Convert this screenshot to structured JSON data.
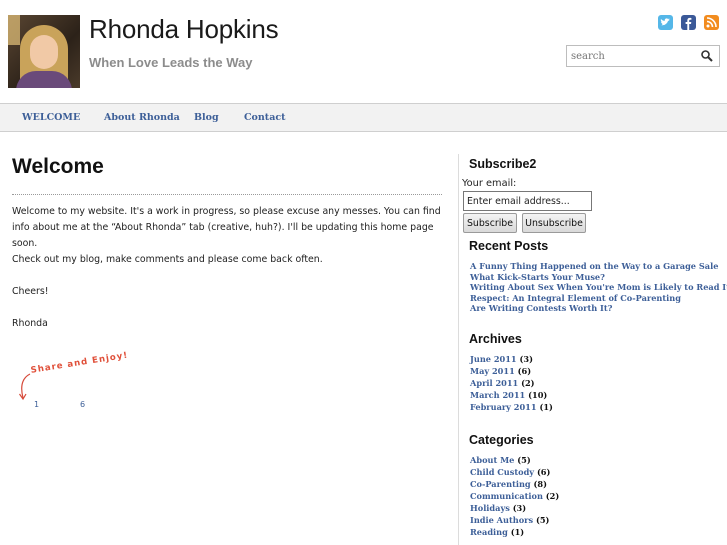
{
  "site": {
    "title": "Rhonda Hopkins",
    "tagline": "When Love Leads the Way"
  },
  "header": {
    "social": [
      {
        "icon": "twitter-icon",
        "color": "#55b7e8"
      },
      {
        "icon": "facebook-icon",
        "color": "#3b5998"
      },
      {
        "icon": "rss-icon",
        "color": "#f28c1f"
      }
    ],
    "search": {
      "placeholder": "search"
    }
  },
  "nav": {
    "items": [
      "WELCOME",
      "About Rhonda",
      "Blog",
      "Contact"
    ]
  },
  "main": {
    "title": "Welcome",
    "paragraphs": [
      "Welcome to my website. It's a work in progress, so please excuse any messes. You can find info about me at the “About Rhonda” tab (creative, huh?). I'll be updating this home page soon.",
      "Check out my blog, make comments and please come back often.",
      "Cheers!",
      "Rhonda"
    ],
    "share": {
      "label": "Share and Enjoy!",
      "counts": [
        "1",
        "6"
      ]
    }
  },
  "sidebar": {
    "subscribe": {
      "title": "Subscribe2",
      "email_label": "Your email:",
      "email_value": "Enter email address...",
      "subscribe_label": "Subscribe",
      "unsubscribe_label": "Unsubscribe"
    },
    "recent_posts": {
      "title": "Recent Posts",
      "items": [
        "A Funny Thing Happened on the Way to a Garage Sale",
        "What Kick-Starts Your Muse?",
        "Writing About Sex When You're Mom is Likely to Read It",
        "Respect: An Integral Element of Co-Parenting",
        "Are Writing Contests Worth It?"
      ]
    },
    "archives": {
      "title": "Archives",
      "items": [
        {
          "label": "June 2011",
          "count": "(3)"
        },
        {
          "label": "May 2011",
          "count": "(6)"
        },
        {
          "label": "April 2011",
          "count": "(2)"
        },
        {
          "label": "March 2011",
          "count": "(10)"
        },
        {
          "label": "February 2011",
          "count": "(1)"
        }
      ]
    },
    "categories": {
      "title": "Categories",
      "items": [
        {
          "label": "About Me",
          "count": "(5)"
        },
        {
          "label": "Child Custody",
          "count": "(6)"
        },
        {
          "label": "Co-Parenting",
          "count": "(8)"
        },
        {
          "label": "Communication",
          "count": "(2)"
        },
        {
          "label": "Holidays",
          "count": "(3)"
        },
        {
          "label": "Indie Authors",
          "count": "(5)"
        },
        {
          "label": "Reading",
          "count": "(1)"
        }
      ]
    }
  }
}
